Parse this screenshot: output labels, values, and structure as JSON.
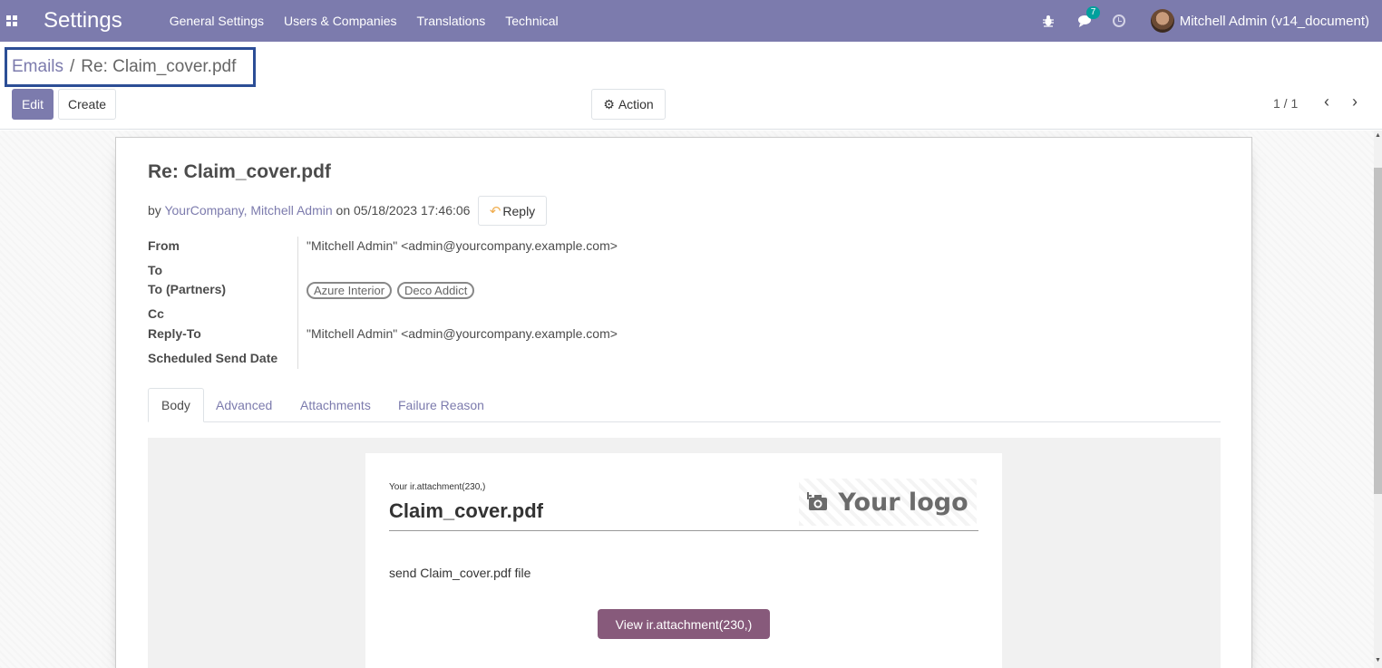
{
  "navbar": {
    "brand": "Settings",
    "menu": [
      "General Settings",
      "Users & Companies",
      "Translations",
      "Technical"
    ],
    "chat_count": "7",
    "user": "Mitchell Admin (v14_document)"
  },
  "breadcrumb": {
    "parent": "Emails",
    "separator": "/",
    "current": "Re: Claim_cover.pdf"
  },
  "toolbar": {
    "edit": "Edit",
    "create": "Create",
    "action": "Action",
    "pager": "1 / 1"
  },
  "message": {
    "title": "Re: Claim_cover.pdf",
    "by": "by",
    "authors": "YourCompany, Mitchell Admin",
    "on": "on 05/18/2023 17:46:06",
    "reply": "Reply"
  },
  "fields": {
    "from_label": "From",
    "from_value": "\"Mitchell Admin\" <admin@yourcompany.example.com>",
    "to_label": "To",
    "to_partners_label": "To (Partners)",
    "partners": [
      "Azure Interior",
      "Deco Addict"
    ],
    "cc_label": "Cc",
    "reply_to_label": "Reply-To",
    "reply_to_value": "\"Mitchell Admin\" <admin@yourcompany.example.com>",
    "scheduled_label": "Scheduled Send Date"
  },
  "tabs": [
    "Body",
    "Advanced",
    "Attachments",
    "Failure Reason"
  ],
  "mail": {
    "subheading": "Your ir.attachment(230,)",
    "title": "Claim_cover.pdf",
    "logo": "Your logo",
    "body": "send Claim_cover.pdf file",
    "button": "View ir.attachment(230,)"
  },
  "colors": {
    "navbar": "#7c7bad",
    "primary_button": "#7c7bad",
    "mail_button": "#875a7b",
    "badge": "#00a09d"
  }
}
